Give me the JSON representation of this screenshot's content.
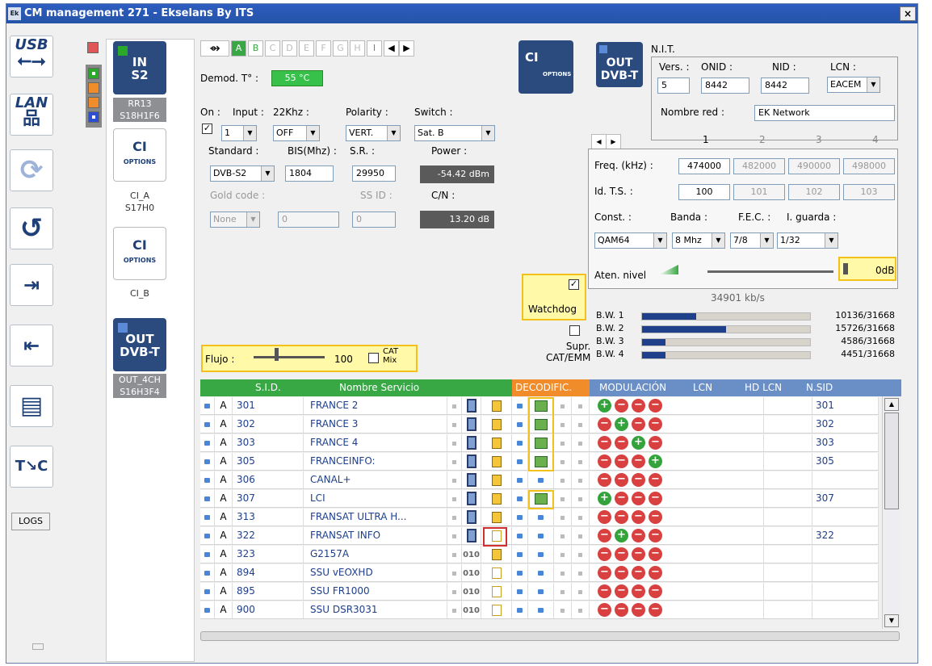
{
  "window": {
    "title": "CM management 271 - Ekselans By ITS",
    "logo": "Ek",
    "close_label": "×"
  },
  "nav": {
    "usb": "USB",
    "lan": "LAN",
    "logs": "LOGS"
  },
  "modules": {
    "in_s2": {
      "line1": "IN",
      "line2": "S2",
      "label1": "RR13",
      "label2": "S18H1F6"
    },
    "ci_a": {
      "title": "CI",
      "sub": "OPTIONS",
      "label1": "CI_A",
      "label2": "S17H0"
    },
    "ci_b": {
      "title": "CI",
      "sub": "OPTIONS",
      "label1": "CI_B"
    },
    "out": {
      "line1": "OUT",
      "line2": "DVB-T",
      "label1": "OUT_4CH",
      "label2": "S16H3F4"
    }
  },
  "input": {
    "tabs": [
      "A",
      "B",
      "C",
      "D",
      "E",
      "F",
      "G",
      "H",
      "I"
    ],
    "active_tab": "A",
    "demod_label": "Demod. T° :",
    "demod_value": "55 °C",
    "on_label": "On :",
    "input_label": "Input :",
    "khz_label": "22Khz :",
    "pol_label": "Polarity :",
    "switch_label": "Switch :",
    "input_value": "1",
    "khz_value": "OFF",
    "pol_value": "VERT.",
    "switch_value": "Sat. B",
    "standard_label": "Standard :",
    "bis_label": "BIS(Mhz) :",
    "sr_label": "S.R. :",
    "power_label": "Power :",
    "standard_value": "DVB-S2",
    "bis_value": "1804",
    "sr_value": "29950",
    "power_value": "-54.42 dBm",
    "gold_label": "Gold code :",
    "ssid_label": "SS ID :",
    "cn_label": "C/N :",
    "gold_value": "None",
    "gold_num": "0",
    "ssid_value": "0",
    "cn_value": "13.20 dB",
    "flujo_label": "Flujo :",
    "flujo_value": "100",
    "cat_label1": "CAT",
    "cat_label2": "Mix"
  },
  "ci_options": {
    "title": "CI",
    "sub": "OPTIONS"
  },
  "watchdog": "Watchdog",
  "supr": {
    "line1": "Supr.",
    "line2": "CAT/EMM"
  },
  "output": {
    "block_line1": "OUT",
    "block_line2": "DVB-T",
    "nit": "N.I.T.",
    "vers_label": "Vers. :",
    "onid_label": "ONID :",
    "nid_label": "NID :",
    "lcn_label": "LCN :",
    "vers": "5",
    "onid": "8442",
    "nid": "8442",
    "lcn": "EACEM",
    "net_label": "Nombre red :",
    "net_name": "EK Network",
    "chan_nums": [
      "1",
      "2",
      "3",
      "4"
    ],
    "freq_label": "Freq. (kHz) :",
    "freqs": [
      "474000",
      "482000",
      "490000",
      "498000"
    ],
    "ts_label": "Id. T.S. :",
    "ts": [
      "100",
      "101",
      "102",
      "103"
    ],
    "const_label": "Const. :",
    "band_label": "Banda :",
    "fec_label": "F.E.C. :",
    "guard_label": "I. guarda :",
    "const": "QAM64",
    "band": "8 Mhz",
    "fec": "7/8",
    "guard": "1/32",
    "aten_label": "Aten. nivel",
    "aten_value": "0dB",
    "rate": "34901 kb/s",
    "bw": [
      {
        "label": "B.W. 1",
        "value": "10136/31668",
        "fill": 0.32
      },
      {
        "label": "B.W. 2",
        "value": "15726/31668",
        "fill": 0.5
      },
      {
        "label": "B.W. 3",
        "value": "4586/31668",
        "fill": 0.14
      },
      {
        "label": "B.W. 4",
        "value": "4451/31668",
        "fill": 0.14
      }
    ]
  },
  "table": {
    "headers": {
      "sid": "S.I.D.",
      "name": "Nombre Servicio",
      "decod": "DECODIFIC.",
      "mod": "MODULACIÓN",
      "lcn": "LCN",
      "hdlcn": "HD LCN",
      "nsid": "N.SID"
    },
    "rows": [
      {
        "a": "A",
        "sid": "301",
        "name": "FRANCE 2",
        "enc": "film",
        "lock": "closed",
        "ci": true,
        "mod": [
          "g",
          "r",
          "r",
          "r"
        ],
        "nsid": "301"
      },
      {
        "a": "A",
        "sid": "302",
        "name": "FRANCE 3",
        "enc": "film",
        "lock": "closed",
        "ci": true,
        "mod": [
          "r",
          "g",
          "r",
          "r"
        ],
        "nsid": "302"
      },
      {
        "a": "A",
        "sid": "303",
        "name": "FRANCE 4",
        "enc": "film",
        "lock": "closed",
        "ci": true,
        "mod": [
          "r",
          "r",
          "g",
          "r"
        ],
        "nsid": "303"
      },
      {
        "a": "A",
        "sid": "305",
        "name": "FRANCEINFO:",
        "enc": "film",
        "lock": "closed",
        "ci": true,
        "mod": [
          "r",
          "r",
          "r",
          "g"
        ],
        "nsid": "305"
      },
      {
        "a": "A",
        "sid": "306",
        "name": "CANAL+",
        "enc": "film",
        "lock": "closed",
        "ci": false,
        "mod": [
          "r",
          "r",
          "r",
          "r"
        ],
        "nsid": ""
      },
      {
        "a": "A",
        "sid": "307",
        "name": "LCI",
        "enc": "film",
        "lock": "closed",
        "ci": true,
        "mod": [
          "g",
          "r",
          "r",
          "r"
        ],
        "nsid": "307"
      },
      {
        "a": "A",
        "sid": "313",
        "name": "FRANSAT ULTRA H...",
        "enc": "film",
        "lock": "closed",
        "ci": false,
        "mod": [
          "r",
          "r",
          "r",
          "r"
        ],
        "nsid": ""
      },
      {
        "a": "A",
        "sid": "322",
        "name": "FRANSAT INFO",
        "enc": "film",
        "lock": "open",
        "ci": false,
        "mod": [
          "r",
          "g",
          "r",
          "r"
        ],
        "nsid": "322"
      },
      {
        "a": "A",
        "sid": "323",
        "name": "G2157A",
        "enc": "010",
        "lock": "closed",
        "ci": false,
        "mod": [
          "r",
          "r",
          "r",
          "r"
        ],
        "nsid": ""
      },
      {
        "a": "A",
        "sid": "894",
        "name": "SSU vEOXHD",
        "enc": "010",
        "lock": "open",
        "ci": false,
        "mod": [
          "r",
          "r",
          "r",
          "r"
        ],
        "nsid": ""
      },
      {
        "a": "A",
        "sid": "895",
        "name": "SSU FR1000",
        "enc": "010",
        "lock": "open",
        "ci": false,
        "mod": [
          "r",
          "r",
          "r",
          "r"
        ],
        "nsid": ""
      },
      {
        "a": "A",
        "sid": "900",
        "name": "SSU DSR3031",
        "enc": "010",
        "lock": "open",
        "ci": false,
        "mod": [
          "r",
          "r",
          "r",
          "r"
        ],
        "nsid": ""
      }
    ]
  },
  "colors": {
    "title_bar": "#2a57b4",
    "nav_blue": "#1f3f78",
    "green_header": "#37a844",
    "orange_header": "#f08c2a",
    "blue_header": "#6a8fc7",
    "highlight": "#f2c21a"
  }
}
